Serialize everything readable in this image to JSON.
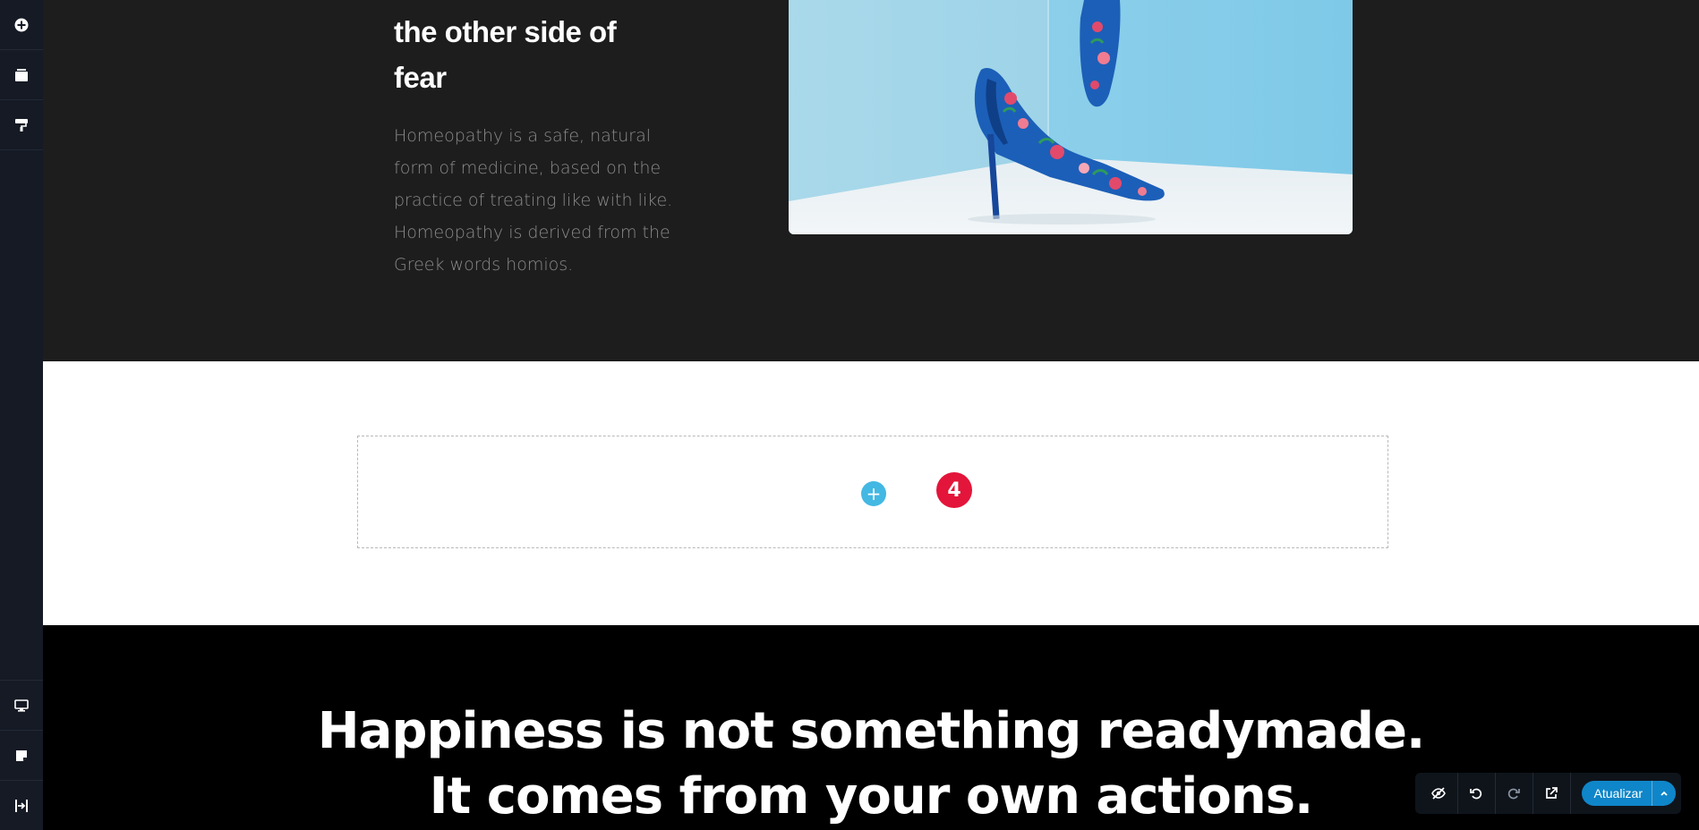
{
  "sidebar": {
    "top_items": [
      {
        "icon": "add-element-icon"
      },
      {
        "icon": "layers-icon"
      },
      {
        "icon": "paint-roller-icon"
      }
    ],
    "bottom_items": [
      {
        "icon": "desktop-icon"
      },
      {
        "icon": "page-settings-icon"
      },
      {
        "icon": "exit-icon"
      }
    ]
  },
  "hero": {
    "headline_line1": "the other side of",
    "headline_line2": "fear",
    "body_lines": [
      "Homeopathy is a safe, natural",
      "form of medicine, based on the",
      "practice of treating like with like.",
      "Homeopathy is derived from the",
      "Greek words homios."
    ],
    "image_alt": "floral-high-heel-shoes-photo"
  },
  "drop_zone": {
    "add_symbol": "+",
    "badge_count": "4"
  },
  "quote": {
    "line1": "Happiness is not something readymade.",
    "line2": "It comes from your own actions."
  },
  "toolbar": {
    "icons": [
      "hide-preview-icon",
      "undo-icon",
      "redo-icon",
      "external-preview-icon"
    ],
    "update_label": "Atualizar",
    "update_caret": "chevron-up-icon"
  },
  "colors": {
    "sidebar_bg": "#151a24",
    "dark_section": "#1d1d1d",
    "accent_blue": "#43b8e3",
    "badge_red": "#e3153a",
    "update_blue": "#0f86c9"
  }
}
